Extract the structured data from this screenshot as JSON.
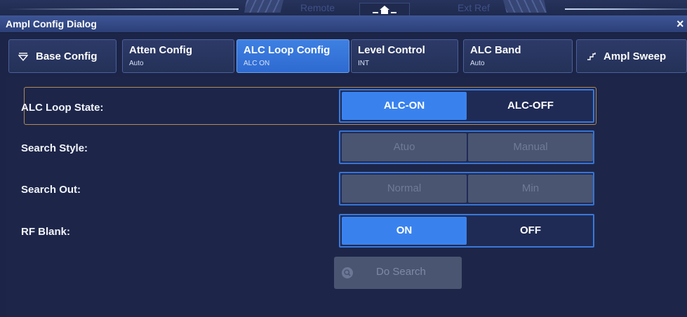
{
  "header": {
    "remote": "Remote",
    "ext_ref": "Ext Ref",
    "home_icon": "home-icon"
  },
  "dialog": {
    "title": "Ampl Config Dialog",
    "close": "×"
  },
  "tabs": [
    {
      "label": "Base Config",
      "sub": "",
      "icon": "triangle-down-icon",
      "active": false
    },
    {
      "label": "Atten Config",
      "sub": "Auto",
      "active": false
    },
    {
      "label": "ALC Loop Config",
      "sub": "ALC ON",
      "active": true
    },
    {
      "label": "Level Control",
      "sub": "INT",
      "active": false
    },
    {
      "label": "ALC Band",
      "sub": "Auto",
      "active": false
    },
    {
      "label": "Ampl Sweep",
      "sub": "",
      "icon": "step-wave-icon",
      "active": false
    }
  ],
  "rows": {
    "alc_loop_state": {
      "label": "ALC Loop State:",
      "options": [
        "ALC-ON",
        "ALC-OFF"
      ],
      "selected": "ALC-ON",
      "enabled": true
    },
    "search_style": {
      "label": "Search Style:",
      "options": [
        "Atuo",
        "Manual"
      ],
      "selected": "",
      "enabled": false
    },
    "search_out": {
      "label": "Search Out:",
      "options": [
        "Normal",
        "Min"
      ],
      "selected": "",
      "enabled": false
    },
    "rf_blank": {
      "label": "RF Blank:",
      "options": [
        "ON",
        "OFF"
      ],
      "selected": "ON",
      "enabled": true
    }
  },
  "do_search": {
    "label": "Do Search",
    "enabled": false
  },
  "colors": {
    "accent": "#3982ee",
    "background": "#1c2547",
    "disabled": "#4a5572",
    "focus_frame": "#b38a55"
  }
}
